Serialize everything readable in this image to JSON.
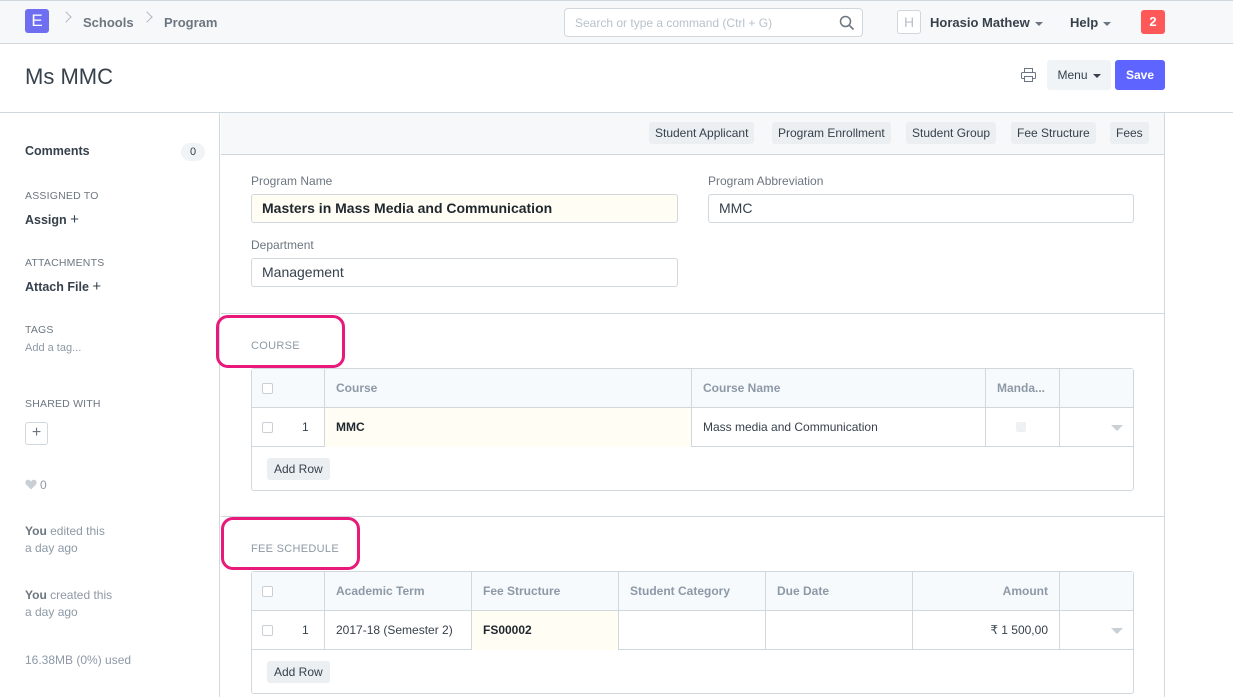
{
  "navbar": {
    "logo_letter": "E",
    "breadcrumbs": [
      "Schools",
      "Program"
    ],
    "search_placeholder": "Search or type a command (Ctrl + G)",
    "avatar_letter": "H",
    "user_name": "Horasio Mathew",
    "help_label": "Help",
    "notification_count": "2"
  },
  "page": {
    "title": "Ms MMC",
    "menu_label": "Menu",
    "save_label": "Save"
  },
  "sidebar": {
    "comments_label": "Comments",
    "comments_count": "0",
    "assigned_to_label": "ASSIGNED TO",
    "assign_label": "Assign",
    "attachments_label": "ATTACHMENTS",
    "attach_label": "Attach File",
    "tags_label": "TAGS",
    "add_tag_label": "Add a tag...",
    "shared_with_label": "SHARED WITH",
    "likes_count": "0",
    "activity": [
      {
        "who": "You",
        "action": " edited this",
        "when": "a day ago"
      },
      {
        "who": "You",
        "action": " created this",
        "when": "a day ago"
      }
    ],
    "storage": "16.38MB (0%) used"
  },
  "links": [
    "Student Applicant",
    "Program Enrollment",
    "Student Group",
    "Fee Structure",
    "Fees"
  ],
  "form": {
    "program_name_label": "Program Name",
    "program_name_value": "Masters in Mass Media and Communication",
    "program_abbr_label": "Program Abbreviation",
    "program_abbr_value": "MMC",
    "department_label": "Department",
    "department_value": "Management"
  },
  "course_section": {
    "heading": "COURSE",
    "columns": [
      "Course",
      "Course Name",
      "Manda..."
    ],
    "rows": [
      {
        "idx": "1",
        "course": "MMC",
        "course_name": "Mass media and Communication"
      }
    ],
    "add_row_label": "Add Row"
  },
  "fee_section": {
    "heading": "FEE SCHEDULE",
    "columns": [
      "Academic Term",
      "Fee Structure",
      "Student Category",
      "Due Date",
      "Amount"
    ],
    "rows": [
      {
        "idx": "1",
        "academic_term": "2017-18 (Semester 2)",
        "fee_structure": "FS00002",
        "student_category": "",
        "due_date": "",
        "amount": "₹ 1 500,00"
      }
    ],
    "add_row_label": "Add Row"
  },
  "colors": {
    "primary": "#5e64ff",
    "logo": "#6f6ef0",
    "notification": "#ff5858",
    "highlight": "#e8197a"
  }
}
